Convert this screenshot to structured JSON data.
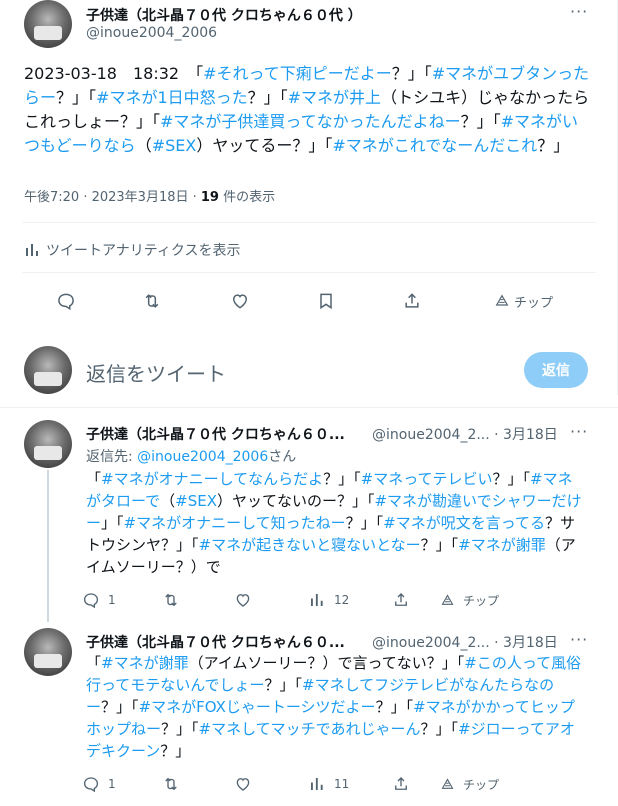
{
  "main_tweet": {
    "author_name": "子供達（北斗晶７０代 クロちゃん６０代 ）",
    "author_handle": "@inoue2004_2006",
    "more_label": "···",
    "text_segments": [
      {
        "text": "2023-03-18　18:32　「",
        "tag": false
      },
      {
        "text": "#それって下痢ピーだよー",
        "tag": true
      },
      {
        "text": "？」「",
        "tag": false
      },
      {
        "text": "#マネがユブタンったらー",
        "tag": true
      },
      {
        "text": "？」「",
        "tag": false
      },
      {
        "text": "#マネが1日中怒った",
        "tag": true
      },
      {
        "text": "？」「",
        "tag": false
      },
      {
        "text": "#マネが井上",
        "tag": true
      },
      {
        "text": "（トシユキ）じゃなかったらこれっしょー？」「",
        "tag": false
      },
      {
        "text": "#マネが子供達買ってなかったんだよねー",
        "tag": true
      },
      {
        "text": "？」「",
        "tag": false
      },
      {
        "text": "#マネがいつもどーりなら",
        "tag": true
      },
      {
        "text": "（",
        "tag": false
      },
      {
        "text": "#SEX",
        "tag": true
      },
      {
        "text": "）ヤッてるー？」「",
        "tag": false
      },
      {
        "text": "#マネがこれでなーんだこれ",
        "tag": true
      },
      {
        "text": "？」",
        "tag": false
      }
    ],
    "timestamp": "午後7:20 · 2023年3月18日 · ",
    "views_count": "19",
    "views_label": " 件の表示",
    "analytics_label": "ツイートアナリティクスを表示",
    "tip_label": "チップ"
  },
  "compose": {
    "placeholder": "返信をツイート",
    "reply_button": "返信"
  },
  "replies": [
    {
      "author_name": "子供達（北斗晶７０代 クロちゃん６０...",
      "author_handle": "@inoue2004_2... · 3月18日",
      "reply_to_prefix": "返信先: ",
      "reply_to_handle": "@inoue2004_2006",
      "reply_to_suffix": "さん",
      "text_segments": [
        {
          "text": "「",
          "tag": false
        },
        {
          "text": "#マネがオナニーしてなんらだよ",
          "tag": true
        },
        {
          "text": "？」「",
          "tag": false
        },
        {
          "text": "#マネってテレビい",
          "tag": true
        },
        {
          "text": "？」「",
          "tag": false
        },
        {
          "text": "#マネがタローで",
          "tag": true
        },
        {
          "text": "（",
          "tag": false
        },
        {
          "text": "#SEX",
          "tag": true
        },
        {
          "text": "）ヤッてないのー？」「",
          "tag": false
        },
        {
          "text": "#マネが勘違いでシャワーだけー",
          "tag": true
        },
        {
          "text": "」「",
          "tag": false
        },
        {
          "text": "#マネがオナニーして知ったねー",
          "tag": true
        },
        {
          "text": "？」「",
          "tag": false
        },
        {
          "text": "#マネが呪文を言ってる",
          "tag": true
        },
        {
          "text": "？サトウシンヤ？」「",
          "tag": false
        },
        {
          "text": "#マネが起きないと寝ないとなー",
          "tag": true
        },
        {
          "text": "？」「",
          "tag": false
        },
        {
          "text": "#マネが謝罪",
          "tag": true
        },
        {
          "text": "（アイムソーリー？）で",
          "tag": false
        }
      ],
      "reply_count": "1",
      "view_count": "12",
      "tip_label": "チップ"
    },
    {
      "author_name": "子供達（北斗晶７０代 クロちゃん６０...",
      "author_handle": "@inoue2004_2... · 3月18日",
      "text_segments": [
        {
          "text": "「",
          "tag": false
        },
        {
          "text": "#マネが謝罪",
          "tag": true
        },
        {
          "text": "（アイムソーリー？）で言ってない？」「",
          "tag": false
        },
        {
          "text": "#この人って風俗行ってモテないんでしょー",
          "tag": true
        },
        {
          "text": "？」「",
          "tag": false
        },
        {
          "text": "#マネしてフジテレビがなんたらなのー",
          "tag": true
        },
        {
          "text": "？」「",
          "tag": false
        },
        {
          "text": "#マネがFOXじゃートーシツだよー",
          "tag": true
        },
        {
          "text": "？」「",
          "tag": false
        },
        {
          "text": "#マネがかかってヒップホップねー",
          "tag": true
        },
        {
          "text": "？」「",
          "tag": false
        },
        {
          "text": "#マネしてマッチであれじゃーん",
          "tag": true
        },
        {
          "text": "？」「",
          "tag": false
        },
        {
          "text": "#ジローってアオデキクーン",
          "tag": true
        },
        {
          "text": "？」",
          "tag": false
        }
      ],
      "reply_count": "1",
      "view_count": "11",
      "tip_label": "チップ"
    }
  ]
}
